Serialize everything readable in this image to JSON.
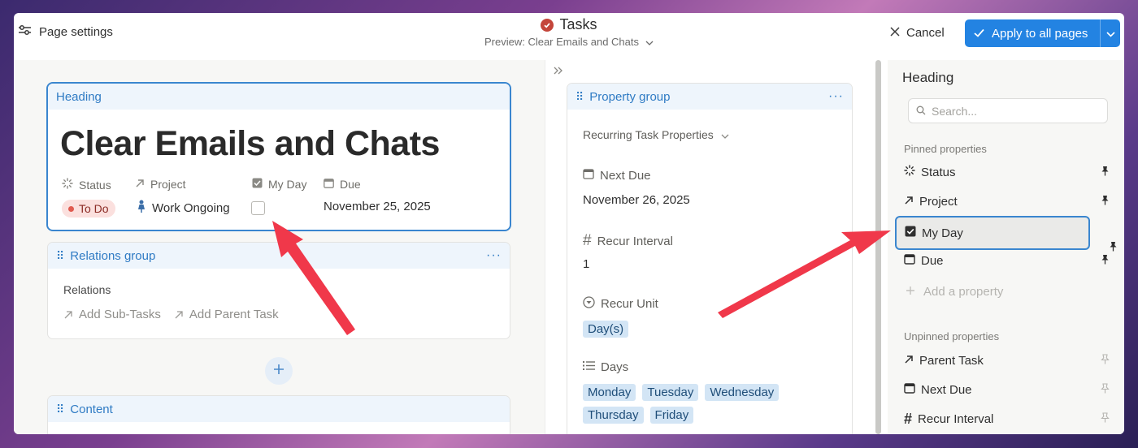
{
  "topbar": {
    "page_settings_label": "Page settings",
    "title": "Tasks",
    "preview_label": "Preview: Clear Emails and Chats",
    "cancel_label": "Cancel",
    "apply_label": "Apply to all pages"
  },
  "heading_card": {
    "header": "Heading",
    "title": "Clear Emails and Chats",
    "props": [
      {
        "label": "Status",
        "icon": "status-icon"
      },
      {
        "label": "Project",
        "icon": "arrow-up-right-icon"
      },
      {
        "label": "My Day",
        "icon": "checkbox-icon"
      },
      {
        "label": "Due",
        "icon": "calendar-icon"
      }
    ],
    "status_value": "To Do",
    "project_value": "Work Ongoing",
    "due_value": "November 25, 2025"
  },
  "relations_card": {
    "header": "Relations group",
    "label": "Relations",
    "links": [
      "Add Sub-Tasks",
      "Add Parent Task"
    ]
  },
  "content_card": {
    "header": "Content"
  },
  "property_group": {
    "header": "Property group",
    "section_label": "Recurring Task Properties",
    "next_due_label": "Next Due",
    "next_due_value": "November 26, 2025",
    "recur_interval_label": "Recur Interval",
    "recur_interval_value": "1",
    "recur_unit_label": "Recur Unit",
    "recur_unit_value": "Day(s)",
    "days_label": "Days",
    "days": [
      "Monday",
      "Tuesday",
      "Wednesday",
      "Thursday",
      "Friday"
    ]
  },
  "right_panel": {
    "heading": "Heading",
    "search_placeholder": "Search...",
    "pinned_label": "Pinned properties",
    "pinned": [
      "Status",
      "Project",
      "My Day",
      "Due"
    ],
    "add_property_label": "Add a property",
    "unpinned_label": "Unpinned properties",
    "unpinned": [
      "Parent Task",
      "Next Due",
      "Recur Interval"
    ]
  },
  "colors": {
    "accent": "#2383e2",
    "selection_border": "#3a86cf",
    "arrow": "#f0384a",
    "tag_bg": "#d3e5f5",
    "status_pill_bg": "#fbe0de"
  }
}
